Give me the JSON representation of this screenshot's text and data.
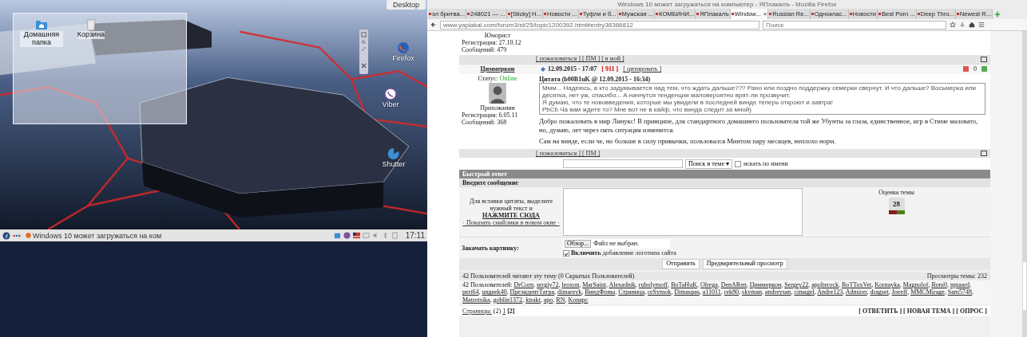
{
  "desktop": {
    "toolbox_label": "Desktop",
    "folder_icons": [
      {
        "label": "Домашняя папка",
        "kind": "folder"
      },
      {
        "label": "Корзина",
        "kind": "trash"
      }
    ],
    "desktop_icons": [
      {
        "label": "Firefox",
        "kind": "firefox"
      },
      {
        "label": "Viber",
        "kind": "viber"
      },
      {
        "label": "Shutter",
        "kind": "shutter"
      }
    ],
    "taskbar": {
      "task": "Windows 10 может загружаться на ком",
      "clock": "17:11"
    }
  },
  "browser": {
    "title": "Windows 10 может загружаться на компьютер - ЯПлакалъ - Mozilla Firefox",
    "tabs": [
      {
        "label": "эл бритва...",
        "selected": false
      },
      {
        "label": "248021 — ...",
        "selected": false
      },
      {
        "label": "[Sticky] H...",
        "selected": false
      },
      {
        "label": "Новости ...",
        "selected": false
      },
      {
        "label": "Туфли и б...",
        "selected": false
      },
      {
        "label": "Мужская ...",
        "selected": false
      },
      {
        "label": "КОМБИНИ...",
        "selected": false
      },
      {
        "label": "ЯПлакалъ",
        "selected": false
      },
      {
        "label": "Window...",
        "selected": true
      },
      {
        "label": "Russian Re...",
        "selected": false
      },
      {
        "label": "Одноклас...",
        "selected": false
      },
      {
        "label": "Новости",
        "selected": false
      },
      {
        "label": "Best Porn ...",
        "selected": false
      },
      {
        "label": "Deep Thro...",
        "selected": false
      },
      {
        "label": "Newest R...",
        "selected": false
      }
    ],
    "tab_close": "×",
    "url": "www.yaplakal.com/forum3/st/25/topic1200392.html#entry38366812",
    "search_placeholder": "Поиск"
  },
  "forum": {
    "prev_post": {
      "rank": "Юморист",
      "registered": "Регистрация: 27.10.12",
      "messages": "Сообщений: 479",
      "actions": "[ пожаловаться ] [ ПМ ] [ в мой ]"
    },
    "post": {
      "author": "Циммеркон",
      "date": "12.09.2015 - 17:07",
      "number": "[ 911 ]",
      "quote_action": "[ цитировать ]",
      "rating": "0",
      "status_label": "Статус:",
      "status": "Online",
      "rank": "Прихожанин",
      "registered": "Регистрация: 6.05.11",
      "messages": "Сообщений: 368",
      "quote_title": "Цитата (b00B1uK @ 12.09.2015 - 16:34)",
      "quote_lines": [
        "Ммм... Надеюсь, а кто задумывается над тем, что ждать дальше??? Рано или поздно поддержку семерки свернут. И что дальше? Восьмерка или десятка, нет уж, спасибо... А начнутся тенденции маловероятно врят-ли прозвучит.",
        "Я думаю, что те нововведения, которые мы увидели в последней винде теперь откроют и завтра!",
        "PbCb Ча вам ждите то? Мне вот не в кайф, что винда следит за мной)"
      ],
      "paragraphs": [
        "Добро пожаловать в мир Линукс! В принципе, для стандартного домашнего пользователя той же Убунты за глаза, единственное, игр в Стиме маловато, но, думаю, лет через пять ситуация изменится.",
        "Сам на винде, если че, но больше в силу привычки, пользовался Минтом пару месяцев, неплохо норм."
      ],
      "actions": "[ пожаловаться ] [ ПМ ]"
    },
    "search": {
      "button": "Поиск в теме ▾",
      "checkbox_label": "искать по имени",
      "checked": false
    },
    "reply": {
      "header": "Быстрый ответ",
      "subheader": "Введите сообщение",
      "hint": "Для вставки цитаты, выделите нужный текст и",
      "hint_link": "НАЖМИТЕ СЮДА",
      "smilies_link": "· Показать смайлики в новом окне ·",
      "rating_label": "Оценка темы",
      "rating": "28",
      "upload_label": "Закачать картинку:",
      "browse": "Обзор...",
      "no_file": "Файл не выбран.",
      "logo_label": "**Включить** добавление логотипа сайта",
      "logo_checked": true,
      "buttons": [
        "Отправить",
        "Предварительный просмотр"
      ]
    },
    "readers": {
      "summary": "42 Пользователей читают эту тему (0 Скрытых Пользователей)",
      "views": "Просмотры темы: 232",
      "label": "42 Пользователей:",
      "separator": ",",
      "users": [
        "DrCorn",
        "sergiy72",
        "leoxon",
        "MarSaint",
        "Alexadnik",
        "rubolymoff",
        "BoTaHuK",
        "Olrega",
        "DenARen",
        "Циммеркон",
        "Sergey22",
        "apolterock",
        "BoTToxVet",
        "Kornayka",
        "Magnolof",
        "Roni0",
        "nptaard",
        "pert64",
        "ungeek40",
        "ПрезидентТатра",
        "dimareyk",
        "ВиндФоны",
        "Страница",
        "orSymok",
        "Dimaspas",
        "a11011",
        "rek80",
        "skyman",
        "andreysan",
        "cimagel",
        "Andre123",
        "Admirer",
        "dragset",
        "Joeeff",
        "MMCMirage",
        "Sam5748",
        "Matrotsika",
        "goblin1372",
        "ktrakt",
        "apo",
        "RN",
        "Konapc"
      ]
    },
    "pages": {
      "label": "Страницы:",
      "count": "(2)",
      "links": [
        {
          "label": "1",
          "selected": false
        },
        {
          "label": "[2]",
          "selected": true
        }
      ],
      "actions": [
        "[ ОТВЕТИТЬ ]",
        "[ НОВАЯ ТЕМА ]",
        "[ ОПРОС ]"
      ]
    }
  }
}
